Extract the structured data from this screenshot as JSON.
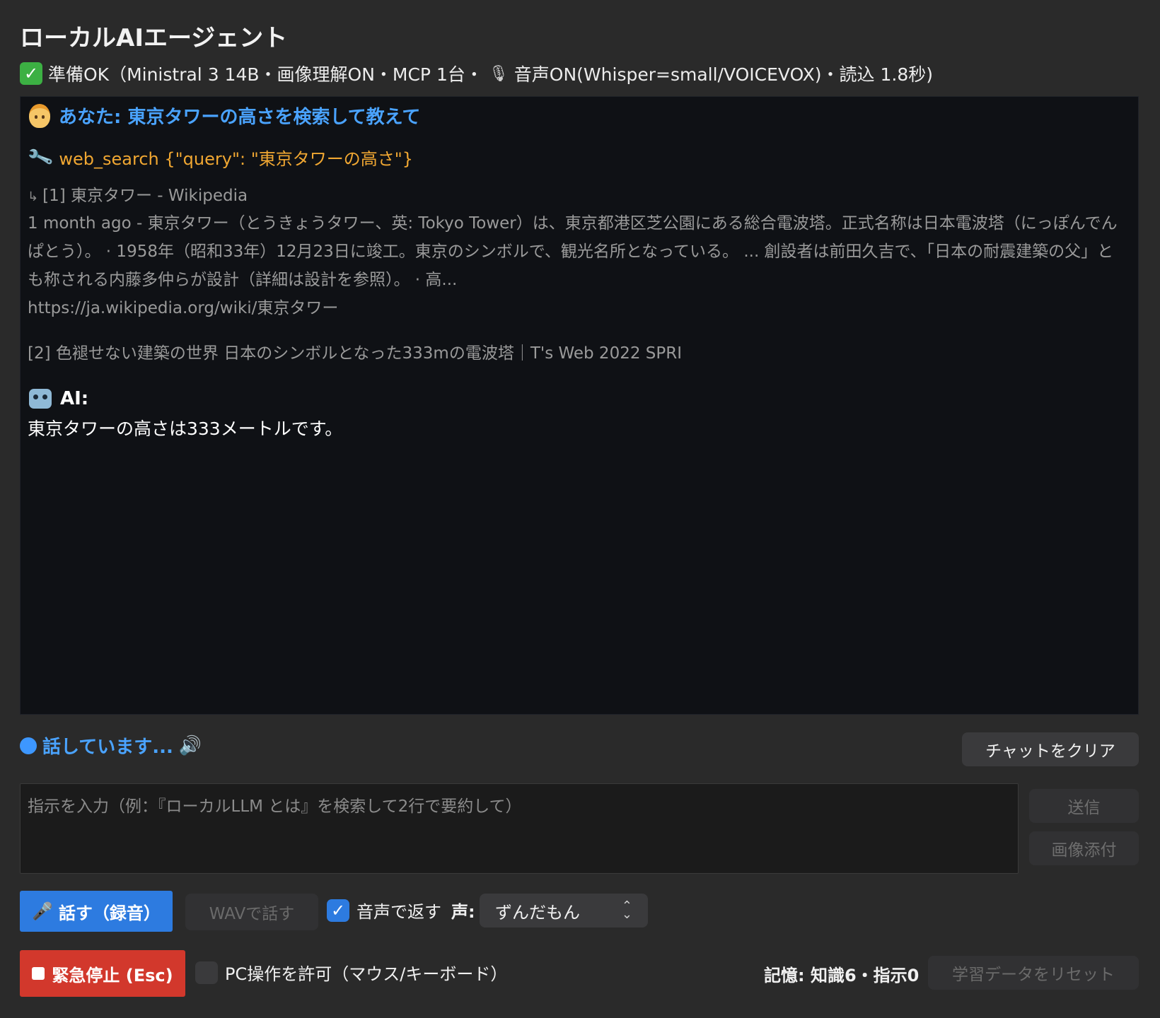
{
  "header": {
    "title": "ローカルAIエージェント",
    "status_check": "✓",
    "status_text_1": "準備OK（Ministral 3 14B・画像理解ON・MCP 1台・",
    "status_mic_icon": "microphone-icon",
    "status_text_2": "音声ON(Whisper=small/VOICEVOX)・読込 1.8秒)"
  },
  "chat": {
    "user_message": "あなた: 東京タワーの高さを検索して教えて",
    "tool_call": "web_search {\"query\": \"東京タワーの高さ\"}",
    "results": {
      "r1_title": "[1] 東京タワー - Wikipedia",
      "r1_body": "1 month ago - 東京タワー（とうきょうタワー、英: Tokyo Tower）は、東京都港区芝公園にある総合電波塔。正式名称は日本電波塔（にっぽんでんぱとう）。 · 1958年（昭和33年）12月23日に竣工。東京のシンボルで、観光名所となっている。 ... 創設者は前田久吉で、「日本の耐震建築の父」とも称される内藤多仲らが設計（詳細は設計を参照）。 · 高...",
      "r1_url": "https://ja.wikipedia.org/wiki/東京タワー",
      "r2_title": "[2] 色褪せない建築の世界 日本のシンボルとなった333mの電波塔｜T's Web 2022 SPRI"
    },
    "ai_label": "AI:",
    "ai_message": "東京タワーの高さは333メートルです。"
  },
  "status_bar": {
    "speaking": "話しています...",
    "clear_button": "チャットをクリア"
  },
  "input": {
    "placeholder": "指示を入力（例：『ローカルLLM とは』を検索して2行で要約して）",
    "send_button": "送信",
    "image_button": "画像添付"
  },
  "controls": {
    "talk_button": "話す（録音）",
    "wav_button": "WAVで話す",
    "voice_reply_label": "音声で返す",
    "voice_reply_checked": true,
    "voice_label": "声:",
    "voice_selected": "ずんだもん",
    "stop_button": "緊急停止 (Esc)",
    "pc_control_label": "PC操作を許可（マウス/キーボード）",
    "pc_control_checked": false,
    "memory": "記憶: 知識6・指示0",
    "reset_button": "学習データをリセット"
  },
  "colors": {
    "accent_blue": "#2d7be0",
    "user_blue": "#4aa3ff",
    "tool_orange": "#f0a732",
    "stop_red": "#d2382c",
    "ok_green": "#3cb043"
  }
}
